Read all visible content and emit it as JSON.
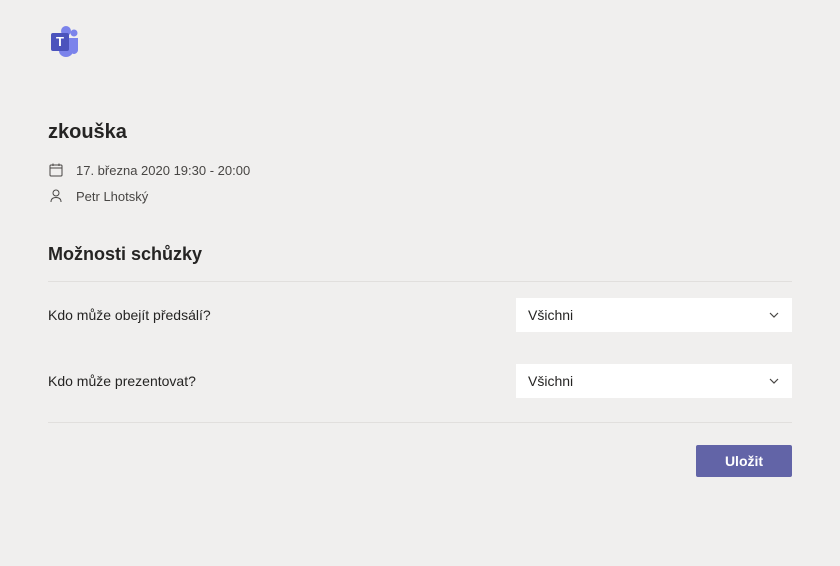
{
  "meeting": {
    "title": "zkouška",
    "datetime": "17. března 2020 19:30 - 20:00",
    "organizer": "Petr Lhotský"
  },
  "options": {
    "heading": "Možnosti schůzky",
    "lobby_bypass": {
      "label": "Kdo může obejít předsálí?",
      "value": "Všichni"
    },
    "who_can_present": {
      "label": "Kdo může prezentovat?",
      "value": "Všichni"
    }
  },
  "buttons": {
    "save": "Uložit"
  }
}
